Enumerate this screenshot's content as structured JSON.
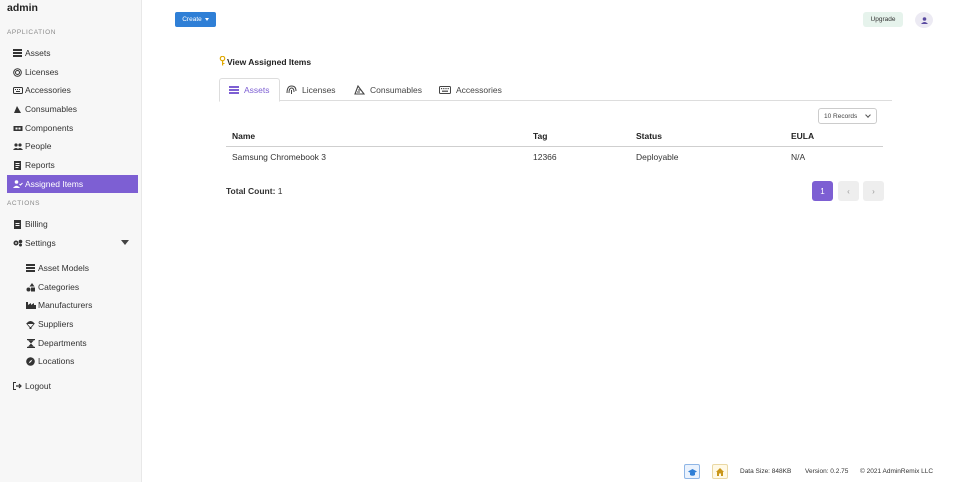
{
  "brand": "admin",
  "sidebar": {
    "application_label": "APPLICATION",
    "actions_label": "ACTIONS",
    "items": [
      {
        "label": "Assets",
        "icon": "list-icon"
      },
      {
        "label": "Licenses",
        "icon": "fingerprint-icon"
      },
      {
        "label": "Accessories",
        "icon": "keyboard-icon"
      },
      {
        "label": "Consumables",
        "icon": "cheese-icon"
      },
      {
        "label": "Components",
        "icon": "chip-icon"
      },
      {
        "label": "People",
        "icon": "users-icon"
      },
      {
        "label": "Reports",
        "icon": "report-icon"
      },
      {
        "label": "Assigned Items",
        "icon": "user-check-icon"
      }
    ],
    "actions": [
      {
        "label": "Billing",
        "icon": "billing-icon"
      },
      {
        "label": "Settings",
        "icon": "cogs-icon"
      }
    ],
    "settings_sub": [
      {
        "label": "Asset Models",
        "icon": "list-icon"
      },
      {
        "label": "Categories",
        "icon": "shapes-icon"
      },
      {
        "label": "Manufacturers",
        "icon": "industry-icon"
      },
      {
        "label": "Suppliers",
        "icon": "parachute-icon"
      },
      {
        "label": "Departments",
        "icon": "hourglass-icon"
      },
      {
        "label": "Locations",
        "icon": "compass-icon"
      }
    ],
    "logout": "Logout"
  },
  "topbar": {
    "create_label": "Create",
    "upgrade_label": "Upgrade"
  },
  "page": {
    "title": "View Assigned Items",
    "tabs": [
      {
        "label": "Assets"
      },
      {
        "label": "Licenses"
      },
      {
        "label": "Consumables"
      },
      {
        "label": "Accessories"
      }
    ],
    "records_label": "10 Records",
    "table": {
      "headers": [
        "Name",
        "Tag",
        "Status",
        "EULA"
      ],
      "rows": [
        [
          "Samsung Chromebook 3",
          "12366",
          "Deployable",
          "N/A"
        ]
      ]
    },
    "total_label": "Total Count:",
    "total_value": "1",
    "pagination": {
      "current": "1",
      "prev": "‹",
      "next": "›"
    }
  },
  "footer": {
    "data_size": "Data Size: 848KB",
    "version": "Version: 0.2.75",
    "copyright": "© 2021 AdminRemix LLC"
  },
  "colors": {
    "accent": "#7d5fd3",
    "primary_button": "#2f7fd6",
    "upgrade_bg": "#e6f3ec",
    "sidebar_bg": "#f7f7f7"
  }
}
